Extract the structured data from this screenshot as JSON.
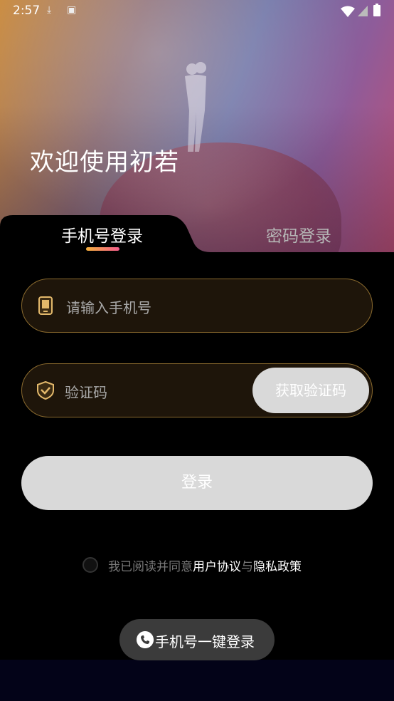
{
  "status_bar": {
    "time": "2:57"
  },
  "hero": {
    "welcome": "欢迎使用初若"
  },
  "tabs": [
    {
      "label": "手机号登录",
      "active": true
    },
    {
      "label": "密码登录",
      "active": false
    }
  ],
  "phone_field": {
    "placeholder": "请输入手机号"
  },
  "code_field": {
    "placeholder": "验证码",
    "get_code_label": "获取验证码"
  },
  "login_button": {
    "label": "登录"
  },
  "agreement": {
    "prefix": "我已阅读并同意",
    "user_agreement": "用户协议",
    "conjunction": "与",
    "privacy_policy": "隐私政策"
  },
  "one_key_login": {
    "label": "手机号一键登录"
  },
  "colors": {
    "accent_start": "#f5b13c",
    "accent_end": "#f35c8d",
    "field_border": "#8a6a2e"
  }
}
